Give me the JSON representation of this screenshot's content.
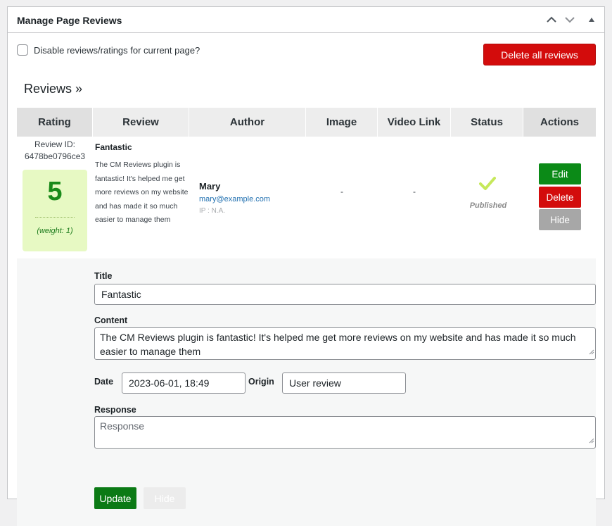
{
  "panel": {
    "title": "Manage Page Reviews",
    "header_icons": [
      "chevron-up-icon",
      "chevron-down-icon",
      "triangle-up-icon"
    ]
  },
  "options": {
    "disable_label": "Disable reviews/ratings for current page?",
    "disable_checked": false,
    "delete_all_label": "Delete all reviews"
  },
  "reviews_heading": "Reviews »",
  "table": {
    "columns": [
      "Rating",
      "Review",
      "Author",
      "Image",
      "Video Link",
      "Status",
      "Actions"
    ],
    "rows": [
      {
        "review_id_label": "Review ID:",
        "review_id": "6478be0796ce3",
        "rating": "5",
        "weight": "(weight: 1)",
        "title": "Fantastic",
        "text": "The CM Reviews plugin is fantastic! It's helped me get more reviews on my website and has made it so much easier to manage them",
        "author_name": "Mary",
        "author_email": "mary@example.com",
        "author_ip": "IP : N.A.",
        "image": "-",
        "video_link": "-",
        "status": "Published",
        "actions": {
          "edit": "Edit",
          "delete": "Delete",
          "hide": "Hide"
        }
      }
    ]
  },
  "edit_form": {
    "title_label": "Title",
    "title_value": "Fantastic",
    "content_label": "Content",
    "content_value": "The CM Reviews plugin is fantastic! It's helped me get more reviews on my website and has made it so much easier to manage them",
    "date_label": "Date",
    "date_value": "2023-06-01, 18:49",
    "origin_label": "Origin",
    "origin_value": "User review",
    "response_label": "Response",
    "response_placeholder": "Response",
    "update_label": "Update",
    "hide_label": "Hide"
  },
  "colors": {
    "danger": "#d30c0c",
    "success": "#0b8a17",
    "score_bg": "#e7f9c3",
    "score_text": "#1a8a1a",
    "link": "#2271b1"
  }
}
